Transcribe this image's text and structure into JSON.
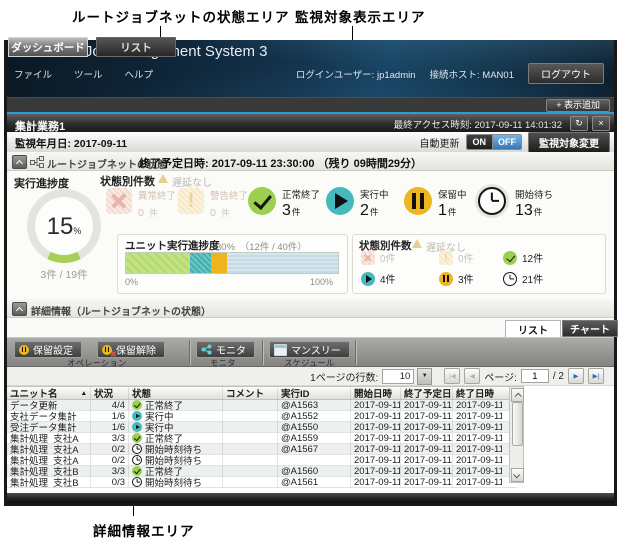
{
  "annotations": {
    "top_left": "ルートジョブネットの状態エリア",
    "top_right": "監視対象表示エリア",
    "bottom": "詳細情報エリア"
  },
  "colors": {
    "accent_blue": "#2e9bd8",
    "normal_green": "#9bd04f",
    "running_teal": "#45b9bb",
    "hold_yellow": "#edb61f",
    "waiting_fill": "#d4e6ee",
    "abnormal_dim": "#f5dad2",
    "warning_dim": "#f8e8c6",
    "progress_green": "#b6dc6f"
  },
  "icons": {
    "close": "×",
    "refresh": "↻",
    "sort_asc": "▲",
    "dropdown": "▼",
    "first": "|◀",
    "prev": "◀",
    "next": "▶",
    "last": "▶|"
  },
  "header": {
    "title": "Automatic Job Management System 3",
    "menus": [
      "ファイル",
      "ツール",
      "ヘルプ"
    ],
    "login_user": "ログインユーザー: jp1admin",
    "host": "接続ホスト: MAN01",
    "logout_button": "ログアウト",
    "tab_dashboard": "ダッシュボード",
    "tab_list": "リスト",
    "add_view_button": "+ 表示追加"
  },
  "panel": {
    "title": "集計業務1",
    "last_access": "最終アクセス時刻: 2017-09-11 14:01:32"
  },
  "monitorbar": {
    "date": "監視年月日: 2017-09-11",
    "auto_update": "自動更新",
    "on": "ON",
    "off": "OFF",
    "change_target_button": "監視対象変更"
  },
  "root_status": {
    "section_title": "ルートジョブネットの状態",
    "scheduled_end": "終了予定日時: 2017-09-11 23:30:00 （残り 09時間29分）",
    "progress": {
      "label": "実行進捗度",
      "value": 15,
      "percent": "15",
      "unit": "%",
      "fraction": "3件 / 19件"
    },
    "status_counts": {
      "label": "状態別件数",
      "delay_note": "遅延なし",
      "items": [
        {
          "label": "異常終了",
          "count": "0",
          "unit": "件"
        },
        {
          "label": "警告終了",
          "count": "0",
          "unit": "件"
        },
        {
          "label": "正常終了",
          "count": "3",
          "unit": "件"
        },
        {
          "label": "実行中",
          "count": "2",
          "unit": "件"
        },
        {
          "label": "保留中",
          "count": "1",
          "unit": "件"
        },
        {
          "label": "開始待ち",
          "count": "13",
          "unit": "件"
        }
      ]
    },
    "unit_progress": {
      "label": "ユニット実行進捗度",
      "summary": "30%　（12件 / 40件）",
      "min": "0%",
      "max": "100%",
      "segments": {
        "normal": 30,
        "running": 10,
        "hold": 7.5,
        "waiting": 52.5
      }
    },
    "unit_status": {
      "label": "状態別件数",
      "delay_note": "遅延なし",
      "cells": [
        {
          "count": "0件"
        },
        {
          "count": "0件"
        },
        {
          "count": "12件"
        },
        {
          "count": "4件"
        },
        {
          "count": "3件"
        },
        {
          "count": "21件"
        }
      ]
    }
  },
  "detail": {
    "section_title": "詳細情報（ルートジョブネットの状態）",
    "tab_list": "リスト",
    "tab_chart": "チャート",
    "toolbar": {
      "hold_set": "保留設定",
      "hold_release": "保留解除",
      "monitor": "モニタ",
      "monthly": "マンスリー",
      "group_operation": "オペレーション",
      "group_monitor": "モニタ",
      "group_schedule": "スケジュール"
    },
    "pager": {
      "rows_label": "1ページの行数:",
      "rows_value": "10",
      "page_label": "ページ:",
      "page_value": "1",
      "page_total": "/ 2"
    },
    "table": {
      "columns": [
        "ユニット名",
        "状況",
        "状態",
        "コメント",
        "実行ID",
        "開始日時",
        "終了予定日時",
        "終了日時"
      ],
      "rows": [
        {
          "unit": "データ更新",
          "progress": "4/4",
          "status": "正常終了",
          "comment": "",
          "exec_id": "@A1563",
          "start": "2017-09-11…",
          "scheduled_end": "2017-09-11 …",
          "end": "2017-09-11…"
        },
        {
          "unit": "支社データ集計",
          "progress": "1/6",
          "status": "実行中",
          "comment": "",
          "exec_id": "@A1552",
          "start": "2017-09-11…",
          "scheduled_end": "2017-09-11 …",
          "end": "2017-09-11…"
        },
        {
          "unit": "受注データ集計",
          "progress": "1/6",
          "status": "実行中",
          "comment": "",
          "exec_id": "@A1550",
          "start": "2017-09-11…",
          "scheduled_end": "2017-09-11 …",
          "end": "2017-09-11…"
        },
        {
          "unit": "集計処理_支社A",
          "progress": "3/3",
          "status": "正常終了",
          "comment": "",
          "exec_id": "@A1559",
          "start": "2017-09-11…",
          "scheduled_end": "2017-09-11 …",
          "end": "2017-09-11…"
        },
        {
          "unit": "集計処理_支社A",
          "progress": "0/2",
          "status": "開始時刻待ち",
          "comment": "",
          "exec_id": "@A1567",
          "start": "2017-09-11…",
          "scheduled_end": "2017-09-11 …",
          "end": "2017-09-11…"
        },
        {
          "unit": "集計処理_支社A",
          "progress": "0/2",
          "status": "開始時刻待ち",
          "comment": "",
          "exec_id": "",
          "start": "2017-09-11…",
          "scheduled_end": "2017-09-11 …",
          "end": "2017-09-11…"
        },
        {
          "unit": "集計処理_支社B",
          "progress": "3/3",
          "status": "正常終了",
          "comment": "",
          "exec_id": "@A1560",
          "start": "2017-09-11…",
          "scheduled_end": "2017-09-11 …",
          "end": "2017-09-11…"
        },
        {
          "unit": "集計処理_支社B",
          "progress": "0/3",
          "status": "開始時刻待ち",
          "comment": "",
          "exec_id": "@A1561",
          "start": "2017-09-11…",
          "scheduled_end": "2017-09-11 …",
          "end": "2017-09-11…"
        }
      ]
    }
  }
}
